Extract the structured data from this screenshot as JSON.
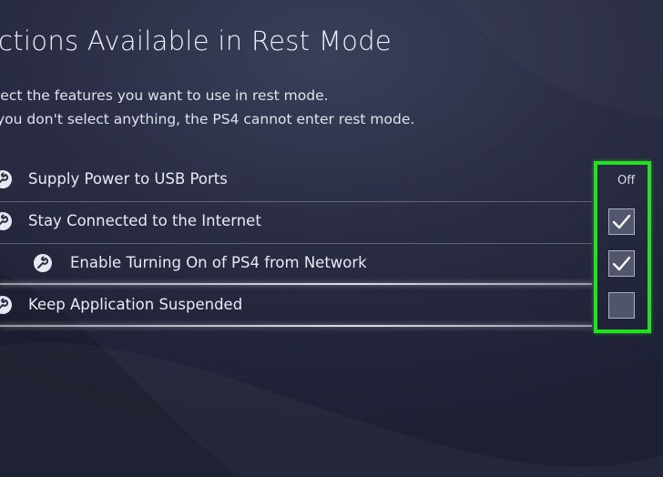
{
  "header": {
    "title": "ctions Available in Rest Mode",
    "description_line1": "lect the features you want to use in rest mode.",
    "description_line2": "you don't select anything, the PS4 cannot enter rest mode."
  },
  "settings": [
    {
      "label": "Supply Power to USB Ports",
      "control": "value",
      "value_text": "Off",
      "icon": "wrench-icon"
    },
    {
      "label": "Stay Connected to the Internet",
      "control": "checkbox",
      "checked": true,
      "icon": "wrench-icon"
    },
    {
      "label": "Enable Turning On of PS4 from Network",
      "control": "checkbox",
      "checked": true,
      "icon": "wrench-icon"
    },
    {
      "label": "Keep Application Suspended",
      "control": "checkbox",
      "checked": false,
      "icon": "wrench-icon"
    }
  ],
  "colors": {
    "background": "#2a2d44",
    "highlight": "#25e022",
    "text": "#e8ebf3"
  }
}
